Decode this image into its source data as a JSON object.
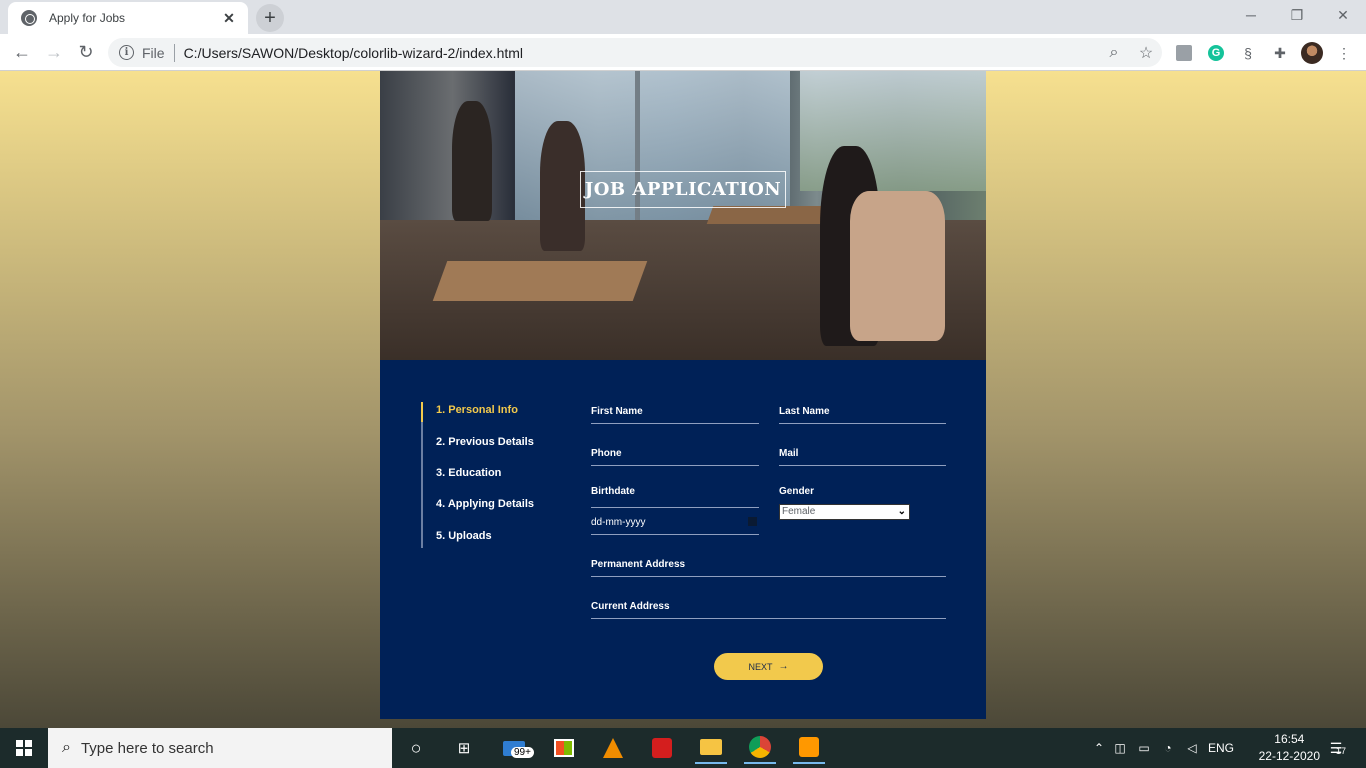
{
  "browser": {
    "tab_title": "Apply for Jobs",
    "new_tab_label": "+",
    "url_scheme": "File",
    "url": "C:/Users/SAWON/Desktop/colorlib-wizard-2/index.html"
  },
  "page": {
    "hero_title": "JOB APPLICATION",
    "steps": [
      {
        "label": "1. Personal Info",
        "active": true
      },
      {
        "label": "2. Previous Details",
        "active": false
      },
      {
        "label": "3. Education",
        "active": false
      },
      {
        "label": "4. Applying Details",
        "active": false
      },
      {
        "label": "5. Uploads",
        "active": false
      }
    ],
    "form": {
      "first_name_label": "First Name",
      "last_name_label": "Last Name",
      "phone_label": "Phone",
      "mail_label": "Mail",
      "birthdate_label": "Birthdate",
      "birthdate_value": "dd-mm-yyyy",
      "gender_label": "Gender",
      "gender_value": "Female",
      "permanent_address_label": "Permanent Address",
      "current_address_label": "Current Address",
      "next_label": "NEXT",
      "next_arrow": "→"
    },
    "colors": {
      "card_bg": "#002157",
      "accent": "#f2c94c"
    }
  },
  "taskbar": {
    "search_placeholder": "Type here to search",
    "mail_badge": "99+",
    "language": "ENG",
    "time": "16:54",
    "date": "22-12-2020",
    "notification_count": "17"
  }
}
